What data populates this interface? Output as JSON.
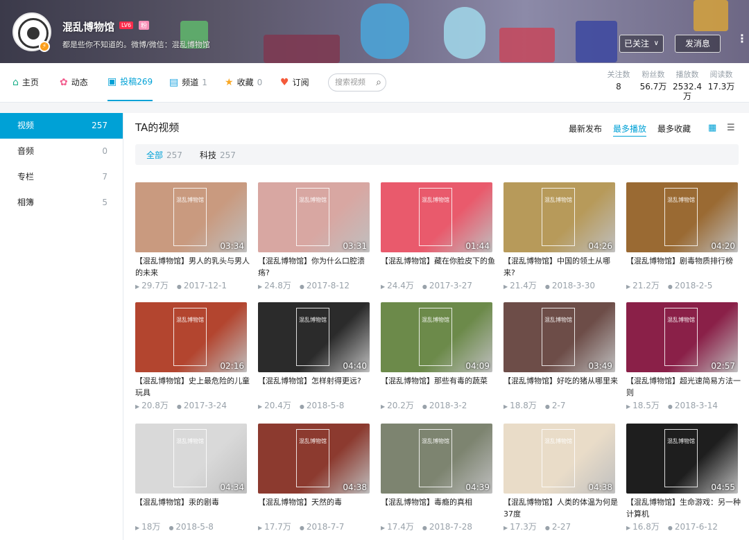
{
  "header": {
    "username": "混乱博物馆",
    "level": "LV6",
    "badge": "粉",
    "sign": "都是些你不知道的。微博/微信：混乱博物馆",
    "follow_label": "已关注",
    "follow_chevron": "∨",
    "message_label": "发消息",
    "more_label": "⋮"
  },
  "nav": {
    "home": "主页",
    "dynamic": "动态",
    "videos": "投稿",
    "videos_count": "269",
    "channels": "频道",
    "channels_count": "1",
    "favorites": "收藏",
    "favorites_count": "0",
    "subscriptions": "订阅",
    "search_placeholder": "搜索视频"
  },
  "stats": {
    "following_label": "关注数",
    "following": "8",
    "fans_label": "粉丝数",
    "fans": "56.7万",
    "plays_label": "播放数",
    "plays_1": "2532.4",
    "plays_2": "万",
    "reads_label": "阅读数",
    "reads": "17.3万"
  },
  "sidebar": [
    {
      "label": "视频",
      "count": "257"
    },
    {
      "label": "音频",
      "count": "0"
    },
    {
      "label": "专栏",
      "count": "7"
    },
    {
      "label": "相簿",
      "count": "5"
    }
  ],
  "main": {
    "title": "TA的视频",
    "sort_latest": "最新发布",
    "sort_plays": "最多播放",
    "sort_favs": "最多收藏",
    "filter_all": "全部",
    "filter_all_count": "257",
    "filter_tech": "科技",
    "filter_tech_count": "257",
    "thumb_watermark": "混乱博物馆"
  },
  "videos": [
    {
      "title": "【混乱博物馆】男人的乳头与男人的未来",
      "duration": "03:34",
      "plays": "29.7万",
      "date": "2017-12-1",
      "color": "#c99a7f"
    },
    {
      "title": "【混乱博物馆】你为什么口腔溃疡?",
      "duration": "03:31",
      "plays": "24.8万",
      "date": "2017-8-12",
      "color": "#d8a7a2"
    },
    {
      "title": "【混乱博物馆】藏在你脸皮下的鱼",
      "duration": "01:44",
      "plays": "24.4万",
      "date": "2017-3-27",
      "color": "#e95a6c"
    },
    {
      "title": "【混乱博物馆】中国的领土从哪来?",
      "duration": "04:26",
      "plays": "21.4万",
      "date": "2018-3-30",
      "color": "#b79a5a"
    },
    {
      "title": "【混乱博物馆】剧毒物质排行榜",
      "duration": "04:20",
      "plays": "21.2万",
      "date": "2018-2-5",
      "color": "#9a6a33"
    },
    {
      "title": "【混乱博物馆】史上最危险的儿童玩具",
      "duration": "02:16",
      "plays": "20.8万",
      "date": "2017-3-24",
      "color": "#b3452f"
    },
    {
      "title": "【混乱博物馆】怎样射得更远?",
      "duration": "04:40",
      "plays": "20.4万",
      "date": "2018-5-8",
      "color": "#2b2b2b"
    },
    {
      "title": "【混乱博物馆】那些有毒的蔬菜",
      "duration": "04:09",
      "plays": "20.2万",
      "date": "2018-3-2",
      "color": "#6c8a4a"
    },
    {
      "title": "【混乱博物馆】好吃的猪从哪里来",
      "duration": "03:49",
      "plays": "18.8万",
      "date": "2-7",
      "color": "#6d4d48"
    },
    {
      "title": "【混乱博物馆】超光速简易方法一则",
      "duration": "02:57",
      "plays": "18.5万",
      "date": "2018-3-14",
      "color": "#8a2048"
    },
    {
      "title": "【混乱博物馆】汞的剧毒",
      "duration": "04:34",
      "plays": "18万",
      "date": "2018-5-8",
      "color": "#d9d9d9"
    },
    {
      "title": "【混乱博物馆】天然的毒",
      "duration": "04:38",
      "plays": "17.7万",
      "date": "2018-7-7",
      "color": "#8c3a2f"
    },
    {
      "title": "【混乱博物馆】毒瘾的真相",
      "duration": "04:39",
      "plays": "17.4万",
      "date": "2018-7-28",
      "color": "#7d8470"
    },
    {
      "title": "【混乱博物馆】人类的体温为何是37度",
      "duration": "04:38",
      "plays": "17.3万",
      "date": "2-27",
      "color": "#e9dcc8"
    },
    {
      "title": "【混乱博物馆】生命游戏：另一种计算机",
      "duration": "04:55",
      "plays": "16.8万",
      "date": "2017-6-12",
      "color": "#1e1e1e"
    }
  ],
  "icons": {
    "home": "⌂",
    "dynamic": "✿",
    "videos": "▣",
    "channels": "▤",
    "favorites": "★",
    "subscriptions": "♥",
    "search": "⌕",
    "play": "▶",
    "clock": "●",
    "grid": "▦",
    "list": "☰"
  },
  "colors": {
    "accent": "#00a1d6",
    "home_icon": "#1cb08a",
    "dynamic_icon": "#f25d8e",
    "channels_icon": "#1ea4e0",
    "fav_icon": "#f9a825",
    "sub_icon": "#f45a3a"
  }
}
